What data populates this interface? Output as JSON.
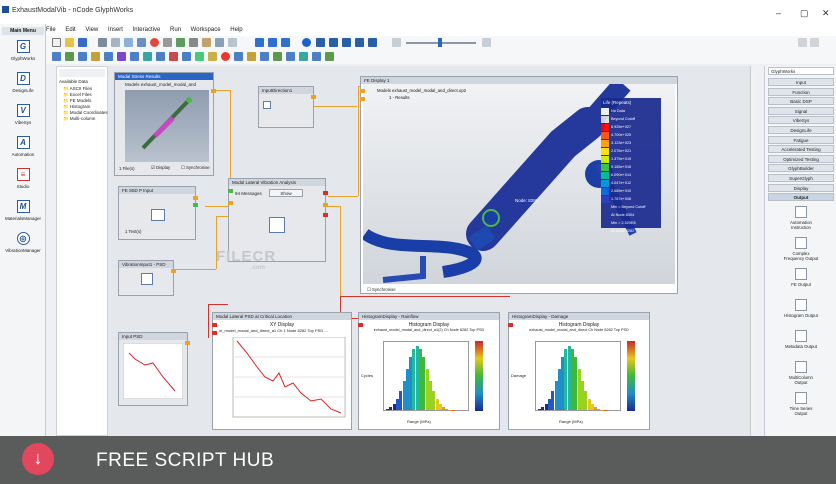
{
  "window": {
    "title": "ExhaustModalVib - nCode GlyphWorks",
    "minimize": "–",
    "maximize": "▢",
    "close": "✕"
  },
  "menu": [
    "File",
    "Edit",
    "View",
    "Insert",
    "Interactive",
    "Run",
    "Workspace",
    "Help"
  ],
  "leftnav": {
    "header": "Main Menu",
    "items": [
      {
        "icon": "G",
        "label": "GlyphWorks"
      },
      {
        "icon": "D",
        "label": "DesignLife"
      },
      {
        "icon": "V",
        "label": "VibeSys"
      },
      {
        "icon": "A",
        "label": "Automation"
      },
      {
        "icon": "≡",
        "label": "Studio"
      },
      {
        "icon": "M",
        "label": "MaterialsManager"
      },
      {
        "icon": "◎",
        "label": "VibrationManager"
      }
    ]
  },
  "browser": {
    "header": "Available Data",
    "items": [
      "ASCII Files",
      "Excel Files",
      "FE Models",
      "Histogram",
      "Modal Coordinates",
      "Multi-column"
    ]
  },
  "nodes": {
    "modal_stress": {
      "title": "Modal Stress Results",
      "subtitle": "Models   exhaust_model_modal_and",
      "files": "1 File(s)",
      "display": "Display",
      "synchronise": "Synchronise"
    },
    "fe_input": {
      "title": "FE S5D P Input",
      "files": "1 Test(s)"
    },
    "vibration": {
      "title": "Modal Lateral Vibration Analysis",
      "messages": "94 Messages",
      "show": "Show"
    },
    "inputdirection": {
      "title": "InputDirection1"
    },
    "vibinput": {
      "title": "VibrationInput1 - PSD"
    },
    "input_psd": {
      "title": "Input PSD"
    },
    "fe_display": {
      "title": "FE Display 1",
      "subtitle": "Models   exhaust_model_modal_and_direct.op2",
      "subtitle2": "1 - Results",
      "legend_title": "Life (Repeats)",
      "legend": [
        "No Data",
        "Beyond Cutoff",
        "6.925e+027",
        "4.700e+025",
        "3.123e+023",
        "2.076e+021",
        "1.379e+019",
        "9.165e+016",
        "6.090e+014",
        "4.047e+012",
        "2.689e+010",
        "1.787e+008",
        "Min = Beyond Cutoff",
        "At Node 8304",
        "Min = 2.529E8",
        "At Node 8282"
      ],
      "node_label": "Node: 8282",
      "synchronise": "Synchronise"
    },
    "xy_display": {
      "title": "Modal Lateral PSD at Critical Location",
      "plot_title": "XY Display",
      "series": "m_model_modal_and_direct_a1  Ch 1  Node 8282  Top PSD  ..."
    },
    "hist1": {
      "title": "HistogramDisplay - Rainflow",
      "plot_title": "Histogram Display",
      "subtitle": "exhaust_model_modal_and_direct_a1(2)  Ch  Node 8282  Top PSD",
      "xlabel": "Range (MPa)",
      "ylabel": "Cycles",
      "yticks": [
        "4E+0",
        "3E+0",
        "2E+0",
        "1E+0",
        "0"
      ],
      "xticks": [
        "0",
        "100",
        "200",
        "300",
        "400",
        "500",
        "600",
        "700",
        "800"
      ]
    },
    "hist2": {
      "title": "HistogramDisplay - Damage",
      "plot_title": "Histogram Display",
      "subtitle": "exhaust_model_modal_and_direct  Ch  Node 8282  Top PSD",
      "xlabel": "Range (MPa)",
      "ylabel": "Damage",
      "yticks": [
        "8e-12",
        "6e-12",
        "4e-12",
        "2e-12",
        "0"
      ],
      "xticks": [
        "0",
        "100",
        "200",
        "300",
        "400",
        "500",
        "600",
        "700",
        "800"
      ]
    }
  },
  "rightpanel": {
    "header": "GlyphWorks",
    "buttons": [
      "Input",
      "Function",
      "Basic DSP",
      "Signal",
      "VibeSys",
      "DesignLife",
      "Fatigue",
      "Accelerated Testing",
      "Optimized Testing",
      "GlyphBuilder",
      "SuperGlyph",
      "Display",
      "Output"
    ],
    "selected": "Output",
    "icons": [
      "Automation Instruction",
      "Complex Frequency Output",
      "FE Output",
      "Histogram Output",
      "Metadata Output",
      "MultiColumn Output",
      "Time Series Output"
    ]
  },
  "watermark": {
    "text": "FILECR",
    "sub": ".com"
  },
  "footer": {
    "icon": "↓",
    "text": "FREE SCRIPT HUB"
  },
  "colors": {
    "accent": "#2a64c5",
    "port_orange": "#e9a22a",
    "port_green": "#4bb84b",
    "port_red": "#d9302a",
    "footer_pink": "#e2475e"
  }
}
